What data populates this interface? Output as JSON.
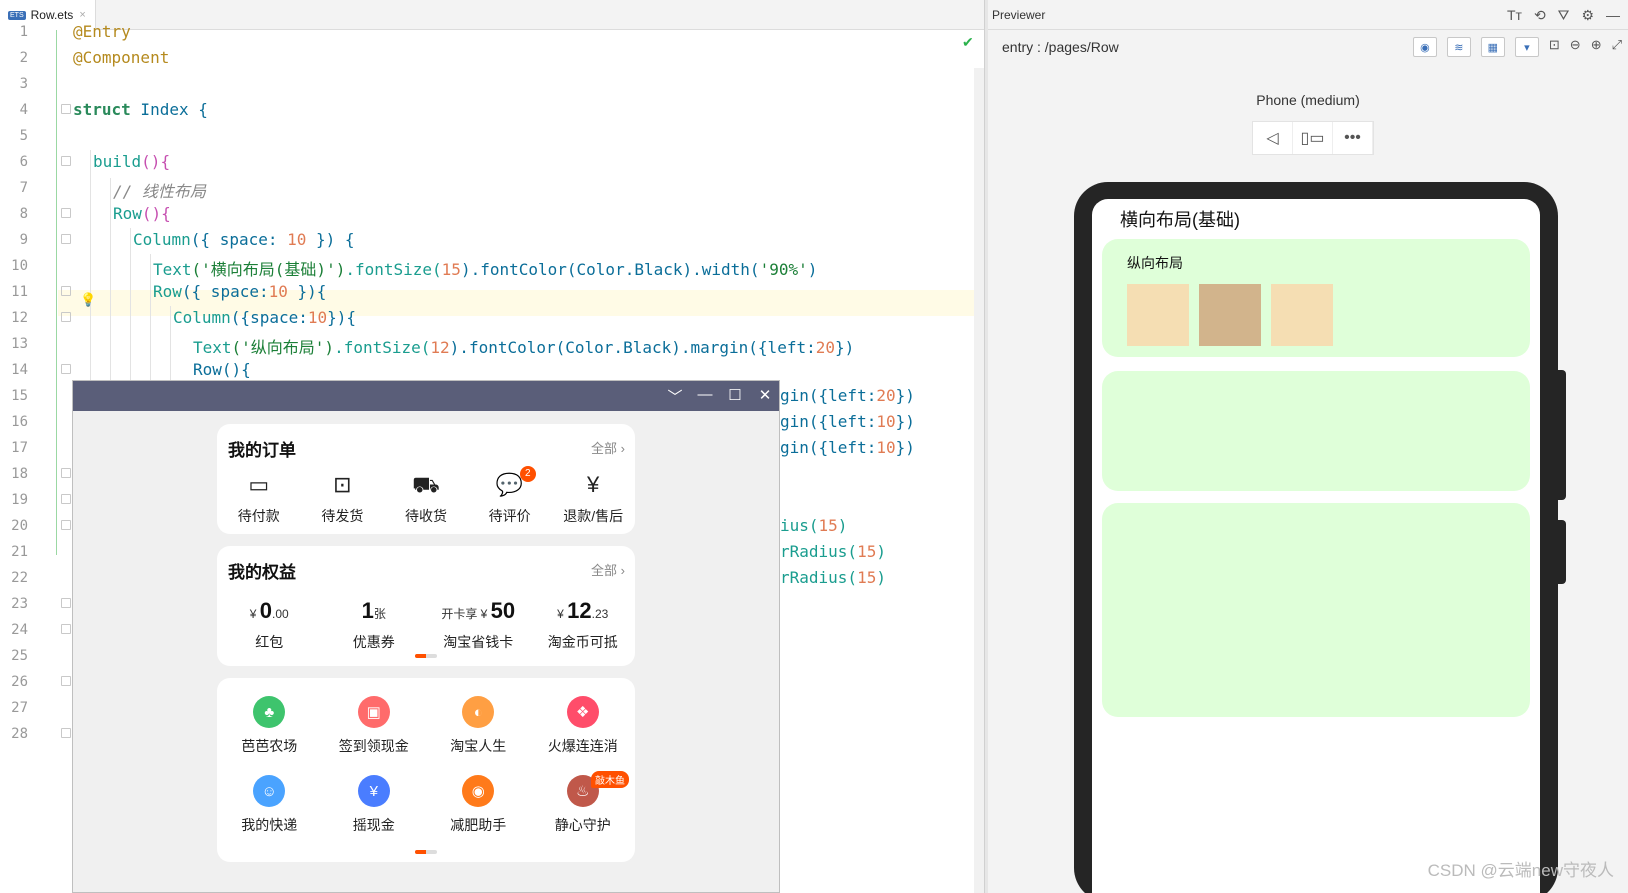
{
  "editor": {
    "tab": {
      "icon_text": "ETS",
      "name": "Row.ets",
      "close": "×"
    },
    "lines": [
      "1",
      "2",
      "3",
      "4",
      "5",
      "6",
      "7",
      "8",
      "9",
      "10",
      "11",
      "12",
      "13",
      "14",
      "15",
      "16",
      "17",
      "18",
      "19",
      "20",
      "21",
      "22",
      "23",
      "24",
      "25",
      "26",
      "27",
      "28"
    ],
    "code": {
      "l1": "@Entry",
      "l2": "@Component",
      "l4a": "struct",
      "l4b": " Index {",
      "l6a": "build",
      "l6b": "(){",
      "l7": "// 线性布局",
      "l8a": "Row",
      "l8b": "(){",
      "l9a": "Column",
      "l9b": "({ space: ",
      "l9c": "10",
      "l9d": " }) {",
      "l10a": "Text",
      "l10b": "('横向布局(基础)')",
      "l10c": ".fontSize(",
      "l10d": "15",
      "l10e": ").fontColor(Color.Black).width(",
      "l10f": "'90%'",
      "l10g": ")",
      "l11a": "Row",
      "l11b": "({ space:",
      "l11c": "10",
      "l11d": " }){",
      "l12a": "Column",
      "l12b": "({space:",
      "l12c": "10",
      "l12d": "}){",
      "l13a": "Text",
      "l13b": "('纵向布局')",
      "l13c": ".fontSize(",
      "l13d": "12",
      "l13e": ").fontColor(Color.Black).margin({left:",
      "l13f": "20",
      "l13g": "})",
      "l14": "Row(){",
      "l15a": "gin({left:",
      "l15b": "20",
      "l15c": "})",
      "l16a": "gin({left:",
      "l16b": "10",
      "l16c": "})",
      "l17a": "gin({left:",
      "l17b": "10",
      "l17c": "})",
      "l20a": "ius(",
      "l20b": "15",
      "l20c": ")",
      "l21a": "rRadius(",
      "l21b": "15",
      "l21c": ")",
      "l22a": "rRadius(",
      "l22b": "15",
      "l22c": ")"
    },
    "status_icon": "✔",
    "bulb_icon": "💡"
  },
  "previewer": {
    "header": "Previewer",
    "header_tools": [
      "Tт",
      "⟲",
      "⛛",
      "⚙",
      "—"
    ],
    "route": "entry : /pages/Row",
    "device_name": "Phone (medium)",
    "device_tools": [
      "◁",
      "▯▭",
      "•••"
    ],
    "toolbar_right": [
      "◉",
      "≋",
      "▦",
      "▾",
      "⊡",
      "⊖",
      "⊕",
      "⤢"
    ],
    "screen": {
      "title": "横向布局(基础)",
      "sub_title": "纵向布局"
    },
    "colors": {
      "card": "#dfffd9",
      "box_light": "#f5deb3",
      "box_dark": "#d2b48c"
    }
  },
  "popup": {
    "controls": [
      "﹀",
      "—",
      "☐",
      "✕"
    ],
    "orders": {
      "title": "我的订单",
      "all": "全部 ›",
      "items": [
        {
          "icon": "▭",
          "label": "待付款"
        },
        {
          "icon": "⊡",
          "label": "待发货"
        },
        {
          "icon": "⛟",
          "label": "待收货"
        },
        {
          "icon": "💬",
          "label": "待评价",
          "badge": "2"
        },
        {
          "icon": "¥",
          "label": "退款/售后"
        }
      ]
    },
    "benefits": {
      "title": "我的权益",
      "all": "全部 ›",
      "items": [
        {
          "pre": "¥ ",
          "big": "0",
          "post": ".00",
          "label": "红包"
        },
        {
          "pre": "",
          "big": "1",
          "post": "张",
          "label": "优惠券"
        },
        {
          "pre": "开卡享 ¥ ",
          "big": "50",
          "post": "",
          "label": "淘宝省钱卡"
        },
        {
          "pre": "¥ ",
          "big": "12",
          "post": ".23",
          "label": "淘金币可抵"
        }
      ]
    },
    "apps": {
      "row1": [
        {
          "icon": "♣",
          "label": "芭芭农场",
          "color": "#3ec46d"
        },
        {
          "icon": "▣",
          "label": "签到领现金",
          "color": "#ff6b6b"
        },
        {
          "icon": "◐",
          "label": "淘宝人生",
          "color": "#ff9f43"
        },
        {
          "icon": "❖",
          "label": "火爆连连消",
          "color": "#ff4d6a"
        }
      ],
      "row2": [
        {
          "icon": "☺",
          "label": "我的快递",
          "color": "#4aa3ff"
        },
        {
          "icon": "¥",
          "label": "摇现金",
          "color": "#4a7dff"
        },
        {
          "icon": "◉",
          "label": "减肥助手",
          "color": "#ff7a1a"
        },
        {
          "icon": "♨",
          "label": "静心守护",
          "color": "#c0584a",
          "tag": "敲木鱼"
        }
      ]
    }
  },
  "watermark": "CSDN @云端new守夜人"
}
